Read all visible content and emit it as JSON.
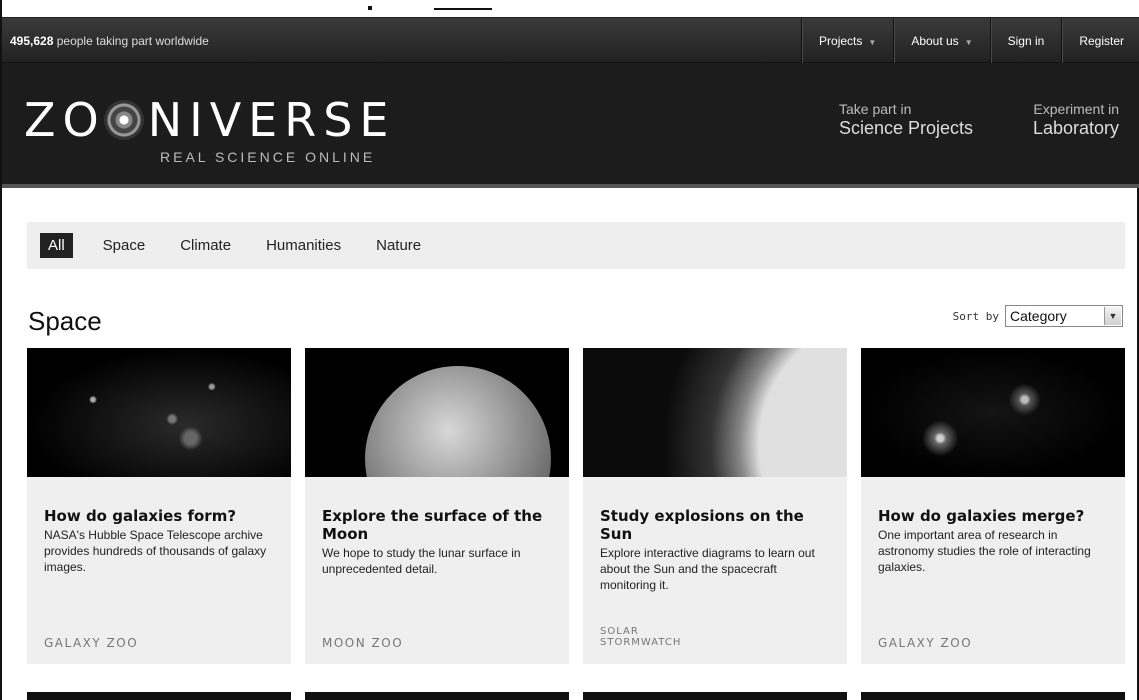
{
  "header": {
    "participants_count": "495,628",
    "participants_text": "people taking part worldwide",
    "nav": [
      {
        "label": "Projects",
        "dropdown": true
      },
      {
        "label": "About us",
        "dropdown": true
      },
      {
        "label": "Sign in",
        "dropdown": false
      },
      {
        "label": "Register",
        "dropdown": false
      }
    ]
  },
  "hero": {
    "logo_word_left": "ZO",
    "logo_word_right": "NIVERSE",
    "logo_subtitle": "REAL SCIENCE ONLINE",
    "links": [
      {
        "small": "Take part in",
        "big": "Science Projects"
      },
      {
        "small": "Experiment in",
        "big": "Laboratory"
      }
    ]
  },
  "filters": {
    "items": [
      "All",
      "Space",
      "Climate",
      "Humanities",
      "Nature"
    ],
    "active": "All"
  },
  "section": {
    "title": "Space",
    "sort_label": "Sort by",
    "sort_value": "Category"
  },
  "cards": [
    {
      "title": "How do galaxies form?",
      "desc": "NASA's Hubble Space Telescope archive provides hundreds of thousands of galaxy images.",
      "logo": "GALAXY ZOO"
    },
    {
      "title": "Explore the surface of the Moon",
      "desc": "We hope to study the lunar surface in unprecedented detail.",
      "logo": "MOON ZOO"
    },
    {
      "title": "Study explosions on the Sun",
      "desc": "Explore interactive diagrams to learn out about the Sun and the spacecraft monitoring it.",
      "logo_line1": "SOLAR",
      "logo_line2": "STORMWATCH"
    },
    {
      "title": "How do galaxies merge?",
      "desc": "One important area of research in astronomy studies the role of interacting galaxies.",
      "logo": "GALAXY ZOO"
    }
  ],
  "icons": {
    "dropdown": "triangle-down",
    "logo_ring": "zooniverse-ring-logo"
  }
}
